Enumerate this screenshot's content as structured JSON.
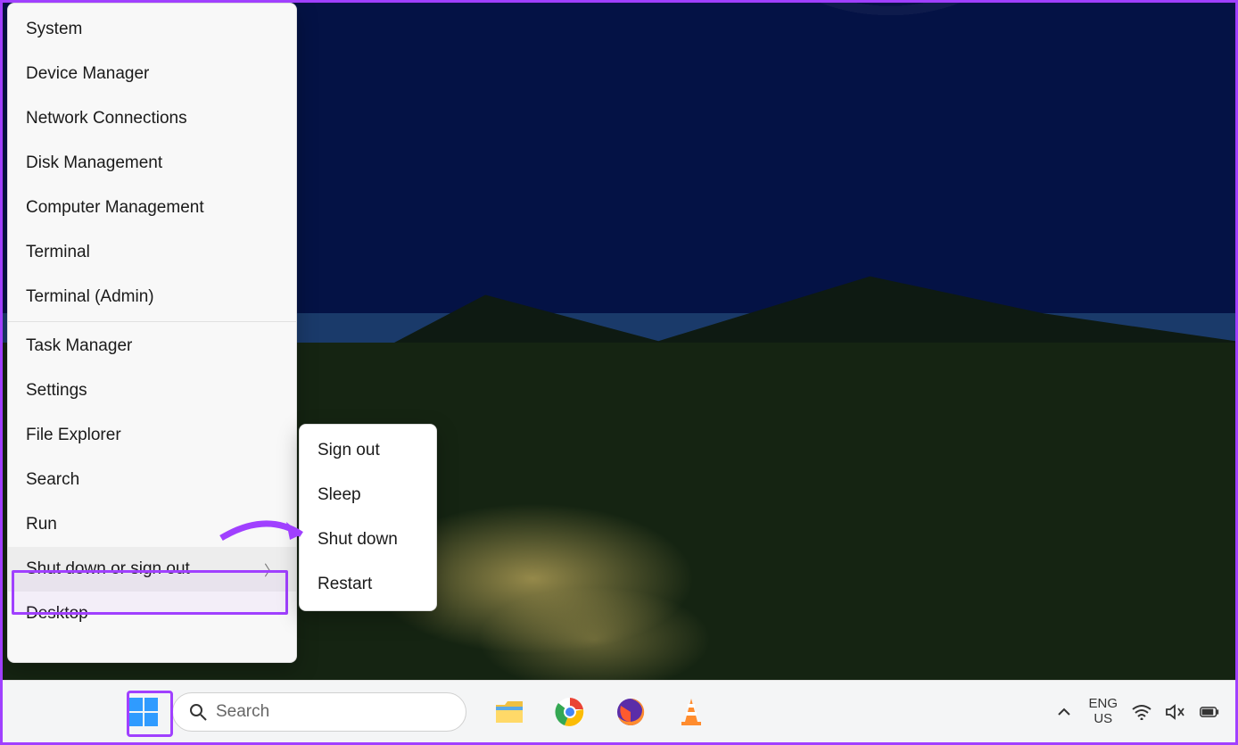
{
  "context_menu": {
    "items": [
      {
        "label": "System"
      },
      {
        "label": "Device Manager"
      },
      {
        "label": "Network Connections"
      },
      {
        "label": "Disk Management"
      },
      {
        "label": "Computer Management"
      },
      {
        "label": "Terminal"
      },
      {
        "label": "Terminal (Admin)"
      },
      {
        "label": "Task Manager"
      },
      {
        "label": "Settings"
      },
      {
        "label": "File Explorer"
      },
      {
        "label": "Search"
      },
      {
        "label": "Run"
      },
      {
        "label": "Shut down or sign out",
        "has_submenu": true,
        "highlighted": true
      },
      {
        "label": "Desktop"
      }
    ],
    "separators_after_index": [
      6
    ]
  },
  "submenu": {
    "items": [
      {
        "label": "Sign out"
      },
      {
        "label": "Sleep"
      },
      {
        "label": "Shut down",
        "pointed": true
      },
      {
        "label": "Restart"
      }
    ]
  },
  "taskbar": {
    "search_placeholder": "Search",
    "apps": [
      "file-explorer",
      "chrome",
      "firefox",
      "vlc"
    ],
    "tray": {
      "lang_top": "ENG",
      "lang_bottom": "US"
    }
  },
  "annotation": {
    "highlight_color": "#a040ff"
  }
}
